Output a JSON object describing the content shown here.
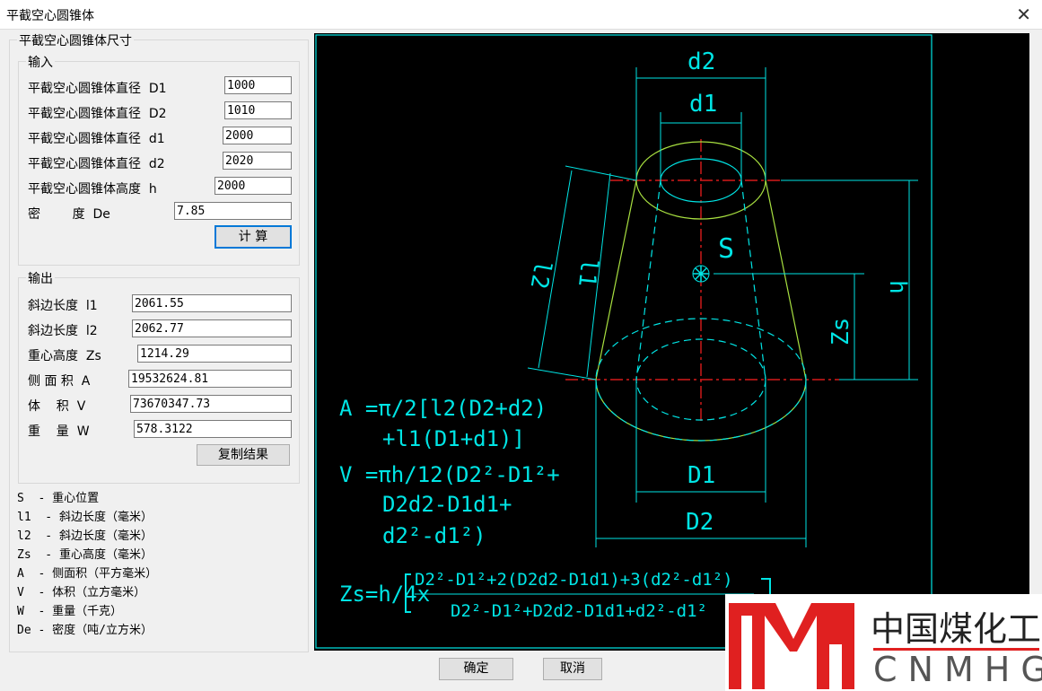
{
  "window": {
    "title": "平截空心圆锥体",
    "close_icon": "close-icon"
  },
  "main_group": "平截空心圆锥体尺寸",
  "input": {
    "title": "输入",
    "fields": [
      {
        "label": "平截空心圆锥体直径  D1",
        "value": "1000"
      },
      {
        "label": "平截空心圆锥体直径  D2",
        "value": "1010"
      },
      {
        "label": "平截空心圆锥体直径  d1",
        "value": "2000"
      },
      {
        "label": "平截空心圆锥体直径  d2",
        "value": "2020"
      },
      {
        "label": "平截空心圆锥体高度  h",
        "value": "2000"
      },
      {
        "label": "密        度  De",
        "value": "7.85"
      }
    ],
    "calc_button": "计  算"
  },
  "output": {
    "title": "输出",
    "fields": [
      {
        "label": "斜边长度  l1",
        "value": "2061.55"
      },
      {
        "label": "斜边长度  l2",
        "value": "2062.77"
      },
      {
        "label": "重心高度  Zs",
        "value": "1214.29"
      },
      {
        "label": "侧 面 积  A",
        "value": "19532624.81"
      },
      {
        "label": "体    积  V",
        "value": "73670347.73"
      },
      {
        "label": "重    量  W",
        "value": "578.3122"
      }
    ],
    "copy_button": "复制结果"
  },
  "legend": [
    "S  - 重心位置",
    "l1  - 斜边长度（毫米）",
    "l2  - 斜边长度（毫米）",
    "Zs  - 重心高度（毫米）",
    "A  - 侧面积（平方毫米）",
    "V  - 体积（立方毫米）",
    "W  - 重量（千克）",
    "De - 密度（吨/立方米）"
  ],
  "drawing": {
    "labels": {
      "d2": "d2",
      "d1": "d1",
      "D1": "D1",
      "D2": "D2",
      "S": "S",
      "h": "h",
      "Zs": "Zs",
      "l1": "l1",
      "l2": "l2"
    },
    "formula_A": [
      "A =π/2[l2(D2+d2)",
      "+l1(D1+d1)]"
    ],
    "formula_V": [
      "V =πh/12(D2²-D1²+",
      "D2d2-D1d1+",
      "d2²-d1²)"
    ],
    "formula_Zs": {
      "prefix": "Zs=h/4x",
      "numerator": "D2²-D1²+2(D2d2-D1d1)+3(d2²-d1²)",
      "denominator": "D2²-D1²+D2d2-D1d1+d2²-d1²"
    },
    "colors": {
      "cyan": "#00e5e5",
      "green": "#a8e040",
      "red": "#ff2020"
    }
  },
  "buttons": {
    "ok": "确定",
    "cancel": "取消"
  },
  "watermark": {
    "cn": "中国煤化工",
    "en": "CNMHG"
  }
}
